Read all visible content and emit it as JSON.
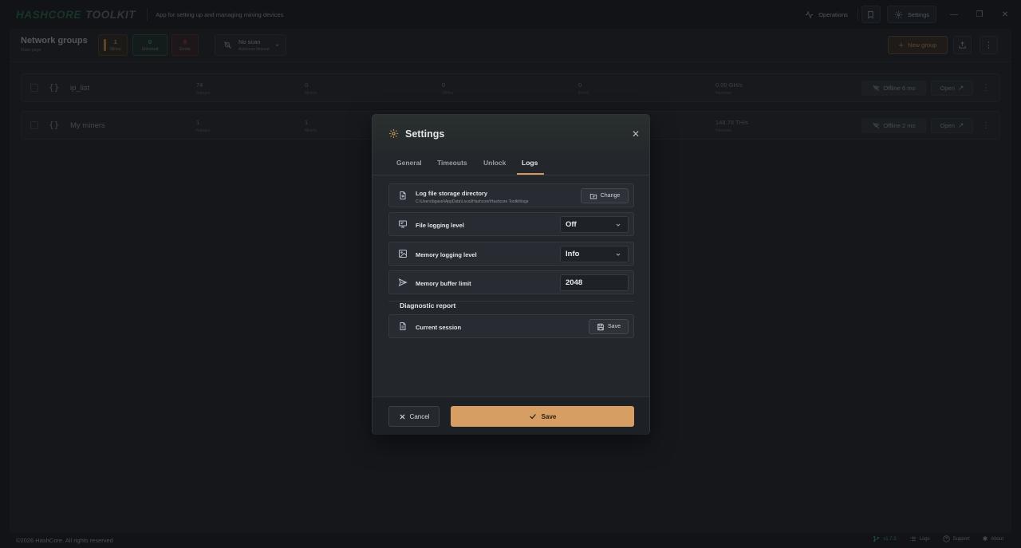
{
  "app": {
    "logo_part1": "HASHCORE",
    "logo_part2": "TOOLKIT",
    "tagline": "App for setting up and managing mining devices"
  },
  "titlebar": {
    "operations_label": "Operations",
    "settings_label": "Settings"
  },
  "toolbar": {
    "title": "Network groups",
    "subtitle": "Main page",
    "stats": {
      "mines_count": "1",
      "mines_label": "Mines",
      "unlocked_count": "0",
      "unlocked_label": "Unlocked",
      "errors_count": "0",
      "errors_label": "Errors"
    },
    "scan_title": "No scan",
    "scan_subtitle": "Autoscan timeout",
    "new_group_label": "New group"
  },
  "rows": [
    {
      "name": "ip_list",
      "ranges": "74",
      "ranges_label": "Ranges",
      "miners": "0",
      "miners_label": "Miners",
      "offline": "0",
      "offline_label": "Offline",
      "errors": "0",
      "errors_label": "Errors",
      "hashrate": "0.00 GH/s",
      "hashrate_label": "Hashrate",
      "status": "Offline 6 mo",
      "open_label": "Open"
    },
    {
      "name": "My miners",
      "ranges": "1",
      "ranges_label": "Ranges",
      "miners": "1",
      "miners_label": "Miners",
      "hashrate": "148.78 TH/s",
      "hashrate_label": "Hashrate",
      "status": "Offline 2 mo",
      "open_label": "Open"
    }
  ],
  "modal": {
    "title": "Settings",
    "tabs": [
      "General",
      "Timeouts",
      "Unlock",
      "Logs"
    ],
    "active_tab": "Logs",
    "log_dir_label": "Log file storage directory",
    "log_dir_path": "C:\\Users\\bgasel\\AppData\\Local\\Hashcore\\Hashcore Toolkit\\logs",
    "change_label": "Change",
    "file_level_label": "File logging level",
    "file_level_value": "Off",
    "memory_level_label": "Memory logging level",
    "memory_level_value": "Info",
    "buffer_label": "Memory buffer limit",
    "buffer_value": "2048",
    "diagnostic_title": "Diagnostic report",
    "session_label": "Current session",
    "session_save_label": "Save",
    "cancel_label": "Cancel",
    "save_label": "Save"
  },
  "statusbar": {
    "copyright": "©2026 HashCore. All rights reserved",
    "version": "v1.7.3",
    "logs": "Logs",
    "support": "Support",
    "about": "About"
  },
  "colors": {
    "accent": "#d69e62",
    "success": "#2f7a57",
    "error": "#7a3438",
    "background": "#16181c"
  }
}
